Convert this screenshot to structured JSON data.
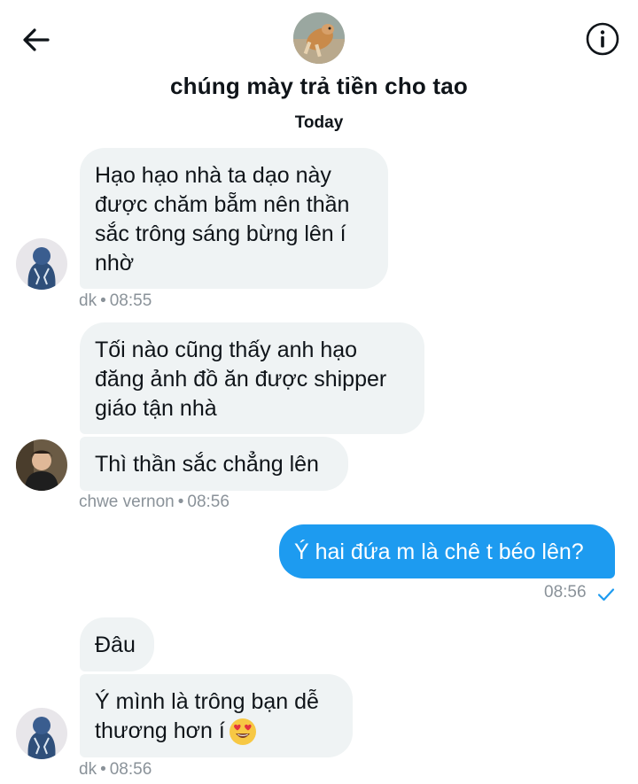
{
  "header": {
    "title": "chúng mày trả tiền cho tao",
    "day_label": "Today",
    "back_icon": "arrow-left-icon",
    "info_icon": "info-icon"
  },
  "messages": [
    {
      "id": 1,
      "sender": "dk",
      "text": "Hạo hạo nhà ta dạo này được chăm bẵm nên thần sắc trông sáng bừng lên í nhờ",
      "time": "08:55"
    },
    {
      "id": 2,
      "sender": "chwe vernon",
      "text": "Tối nào cũng thấy anh hạo đăng ảnh đồ ăn được shipper giáo tận nhà"
    },
    {
      "id": 3,
      "sender": "chwe vernon",
      "text": "Thì thần sắc chẳng lên",
      "time": "08:56"
    },
    {
      "id": 4,
      "sender": "me",
      "text": "Ý hai đứa m là chê t béo lên?",
      "time": "08:56",
      "status": "read"
    },
    {
      "id": 5,
      "sender": "dk",
      "text": "Đâu"
    },
    {
      "id": 6,
      "sender": "dk",
      "text": "Ý mình là trông bạn dễ thương hơn í",
      "time": "08:56",
      "emoji": "heart-eyes-emoji"
    }
  ],
  "meta_dot": "•",
  "colors": {
    "outgoing_bubble": "#1d9bf0",
    "incoming_bubble": "#eff3f4",
    "meta_text": "#8a9299",
    "check": "#1d9bf0"
  }
}
